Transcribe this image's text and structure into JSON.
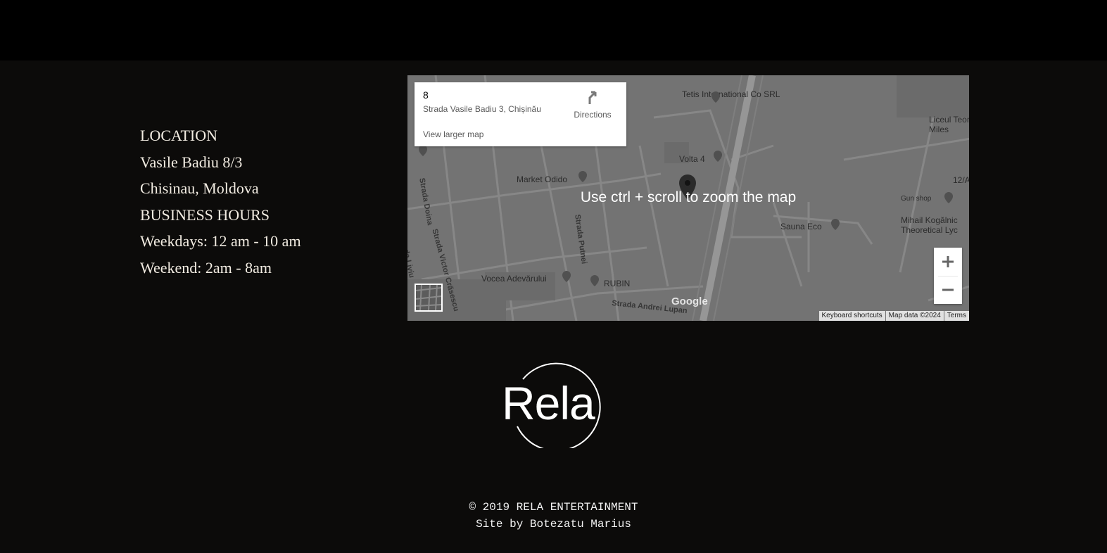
{
  "contact": {
    "location_heading": "LOCATION",
    "address_line1": "Vasile Badiu 8/3",
    "address_line2": "Chisinau, Moldova",
    "hours_heading": "BUSINESS HOURS",
    "weekdays": "Weekdays: 12 am - 10 am",
    "weekend": "Weekend: 2am - 8am"
  },
  "map": {
    "card_title": "8",
    "card_address": "Strada Vasile Badiu 3, Chișinău",
    "directions_label": "Directions",
    "view_larger_label": "View larger map",
    "zoom_hint": "Use ctrl + scroll to zoom the map",
    "zoom_in": "+",
    "zoom_out": "−",
    "attribution": [
      "Keyboard shortcuts",
      "Map data ©2024",
      "Terms"
    ],
    "google_label": "Google",
    "places": {
      "tetis": "Tetis International\nCo SRL",
      "volta": "Volta 4",
      "market": "Market Odido",
      "sauna": "Sauna Eco",
      "vocea": "Vocea Adevărului",
      "rubin": "RUBIN",
      "gunshop": "Gun shop",
      "liceul": "Liceul Teor\nMiles",
      "mihail": "Mihail Kogălnic\nTheoretical Lyc",
      "num12": "12/A"
    },
    "streets": {
      "doina": "Strada Doina",
      "putnei": "Strada Putnei",
      "crasescu": "Strada Victor Crăsescu",
      "lupan": "Strada Andrei Lupan",
      "liviu": "ada Liviu"
    }
  },
  "brand": {
    "logo_text": "Rela"
  },
  "footer": {
    "copyright": "© 2019 RELA ENTERTAINMENT",
    "credit": "Site by Botezatu Marius"
  }
}
